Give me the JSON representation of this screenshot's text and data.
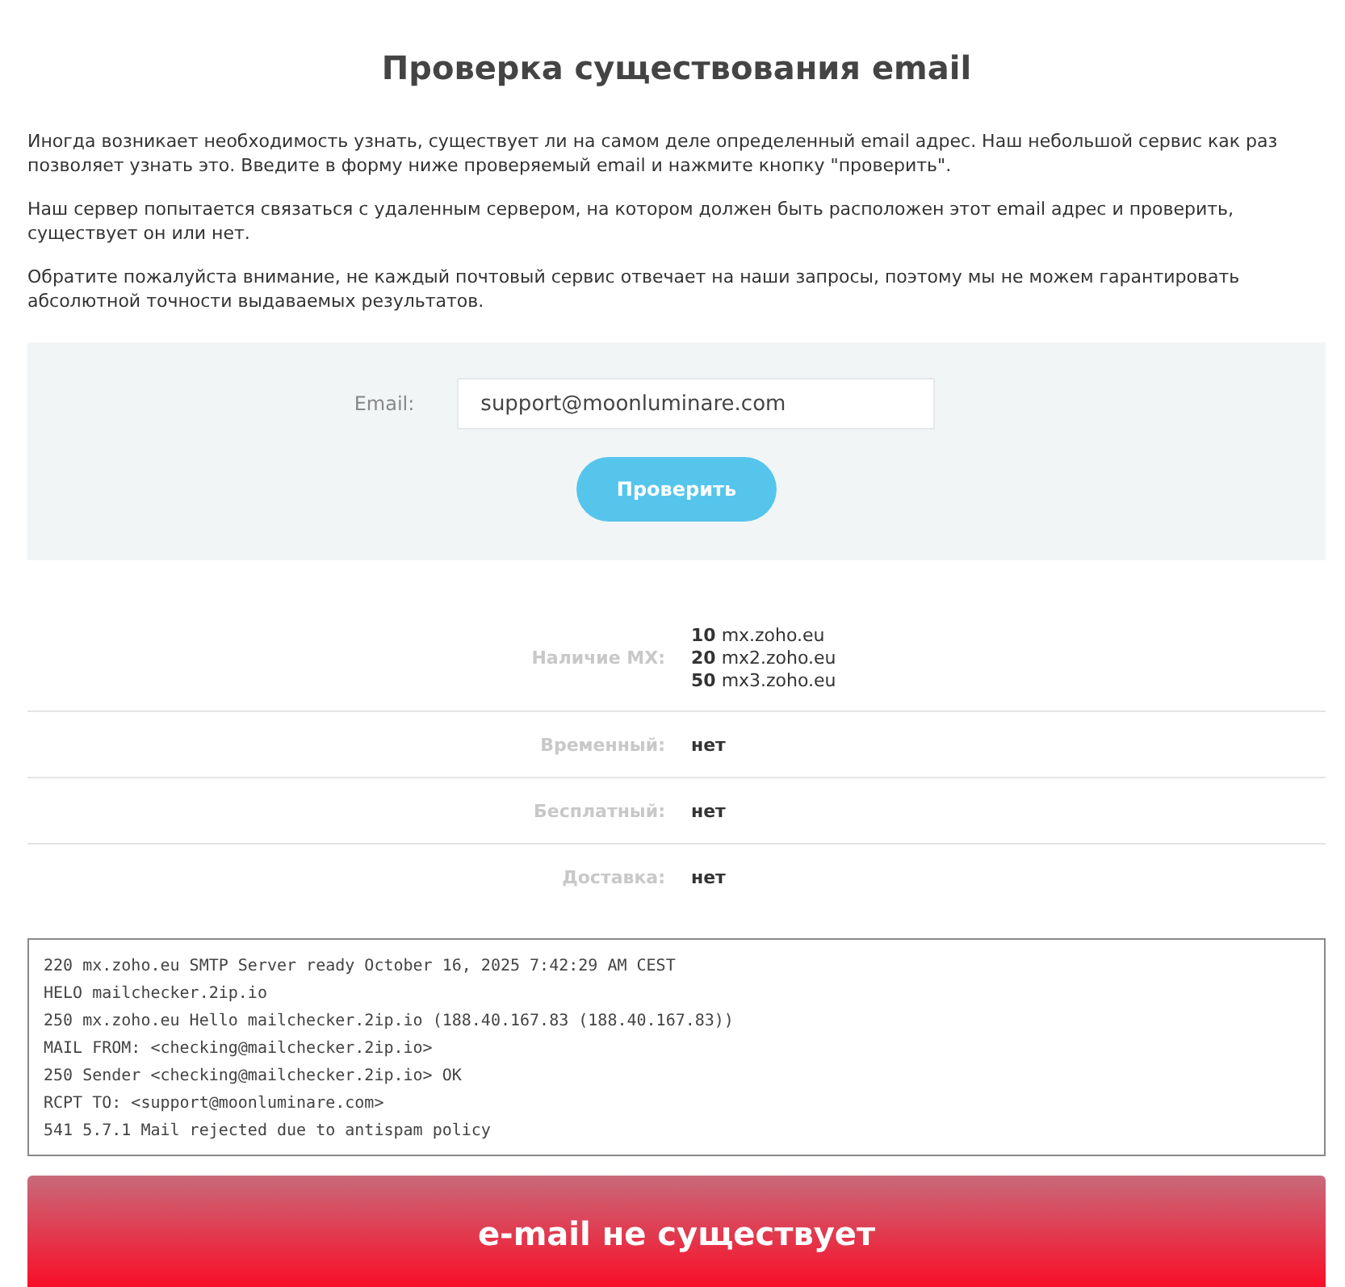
{
  "title": "Проверка существования email",
  "paragraphs": [
    "Иногда возникает необходимость узнать, существует ли на самом деле определенный email адрес. Наш небольшой сервис как раз позволяет узнать это. Введите в форму ниже проверяемый email и нажмите кнопку \"проверить\".",
    "Наш сервер попытается связаться с удаленным сервером, на котором должен быть расположен этот email адрес и проверить, существует он или нет.",
    "Обратите пожалуйста внимание, не каждый почтовый сервис отвечает на наши запросы, поэтому мы не можем гарантировать абсолютной точности выдаваемых результатов."
  ],
  "form": {
    "label": "Email:",
    "value": "support@moonluminare.com",
    "button": "Проверить"
  },
  "results": [
    {
      "kind": "mx",
      "label": "Наличие MX:",
      "records": [
        {
          "priority": "10",
          "host": "mx.zoho.eu"
        },
        {
          "priority": "20",
          "host": "mx2.zoho.eu"
        },
        {
          "priority": "50",
          "host": "mx3.zoho.eu"
        }
      ]
    },
    {
      "kind": "text",
      "label": "Временный:",
      "value": "нет"
    },
    {
      "kind": "text",
      "label": "Бесплатный:",
      "value": "нет"
    },
    {
      "kind": "text",
      "label": "Доставка:",
      "value": "нет"
    }
  ],
  "log": [
    "220 mx.zoho.eu SMTP Server ready October 16, 2025 7:42:29 AM CEST",
    "HELO mailchecker.2ip.io",
    "250 mx.zoho.eu Hello mailchecker.2ip.io (188.40.167.83 (188.40.167.83))",
    "MAIL FROM: <checking@mailchecker.2ip.io>",
    "250 Sender <checking@mailchecker.2ip.io> OK",
    "RCPT TO: <support@moonluminare.com>",
    "541 5.7.1 Mail rejected due to antispam policy"
  ],
  "verdict": "e-mail не существует"
}
